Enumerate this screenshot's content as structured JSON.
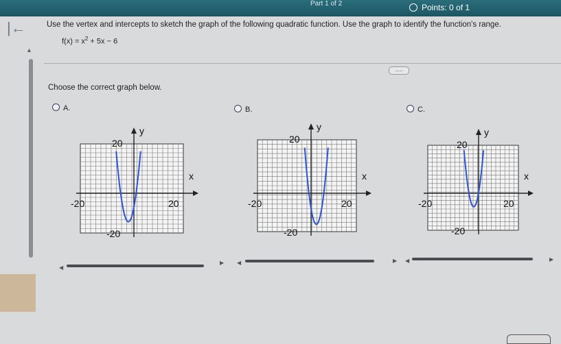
{
  "header": {
    "part": "Part 1 of 2",
    "points": "Points: 0 of 1"
  },
  "nav": {
    "back_icon": "back-arrow-icon"
  },
  "question": {
    "instruction": "Use the vertex and intercepts to sketch the graph of the following quadratic function. Use the graph to identify the function's range.",
    "func_main": "f(x) = x",
    "func_exp": "2",
    "func_rest": " + 5x − 6",
    "more": "....."
  },
  "prompt": "Choose the correct graph below.",
  "options": [
    {
      "label": "A.",
      "selected": false
    },
    {
      "label": "B.",
      "selected": false
    },
    {
      "label": "C.",
      "selected": false
    }
  ],
  "graph_labels": {
    "y": "y",
    "x": "x",
    "top": "20",
    "bottom": "-20",
    "left": "-20",
    "right": "20"
  },
  "chart_data": [
    {
      "type": "line",
      "function": "option A",
      "vertex": [
        -2.5,
        -12.25
      ],
      "xlim": [
        -20,
        20
      ],
      "ylim": [
        -20,
        20
      ]
    },
    {
      "type": "line",
      "function": "option B",
      "vertex": [
        2.5,
        -12.25
      ],
      "xlim": [
        -20,
        20
      ],
      "ylim": [
        -20,
        20
      ]
    },
    {
      "type": "line",
      "function": "option C",
      "vertex": [
        -2.5,
        -6
      ],
      "xlim": [
        -20,
        20
      ],
      "ylim": [
        -20,
        20
      ]
    }
  ]
}
